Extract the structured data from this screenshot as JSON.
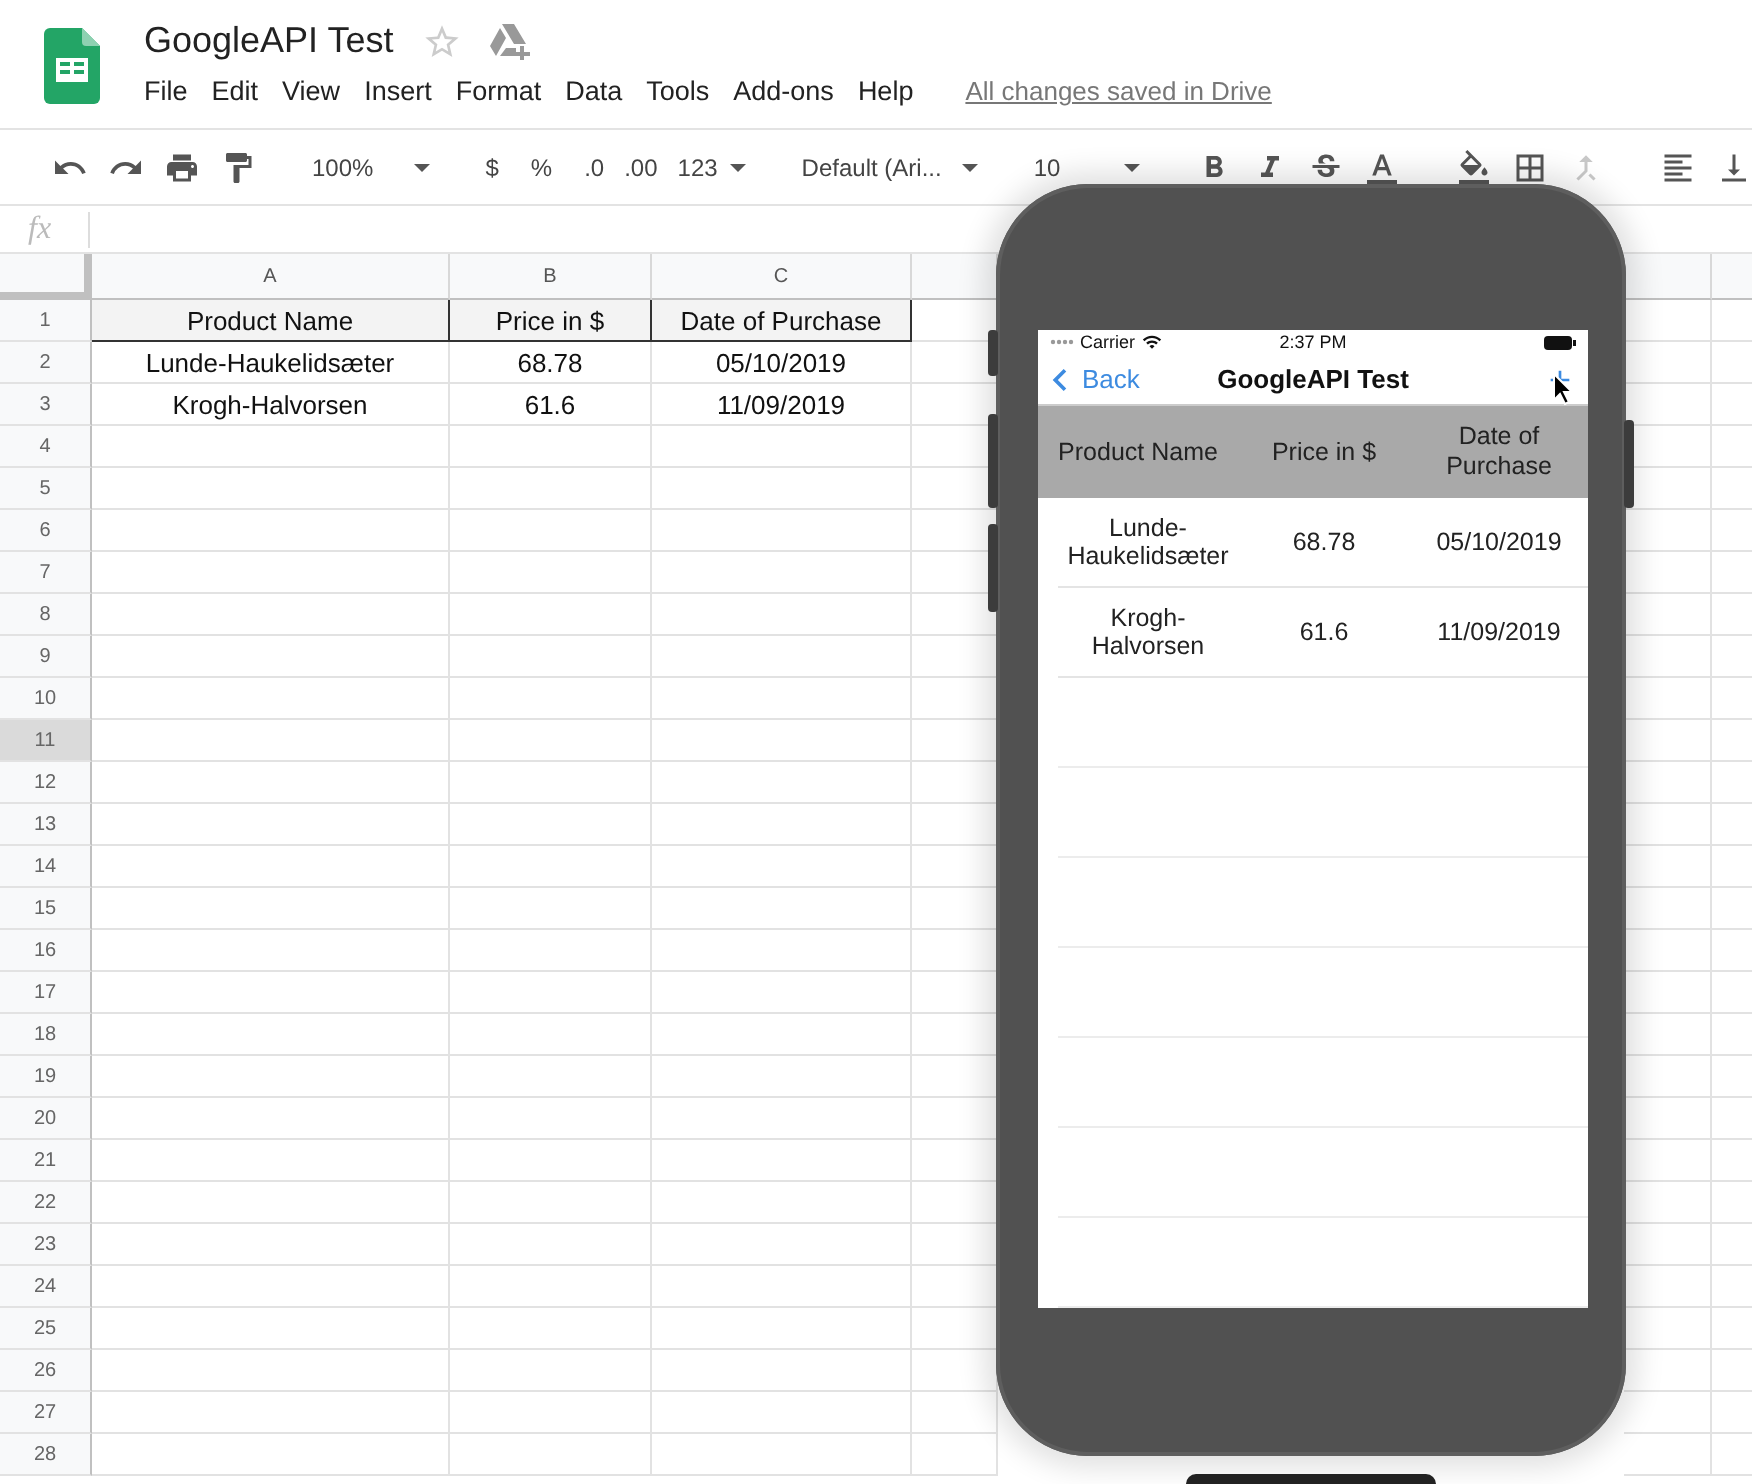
{
  "document": {
    "title": "GoogleAPI Test",
    "starred": false,
    "menu": [
      "File",
      "Edit",
      "View",
      "Insert",
      "Format",
      "Data",
      "Tools",
      "Add-ons",
      "Help"
    ],
    "save_status": "All changes saved in Drive"
  },
  "toolbar": {
    "zoom": "100%",
    "currency": "$",
    "percent": "%",
    "decrease_decimals": ".0",
    "increase_decimals": ".00",
    "more_formats": "123",
    "font": "Default (Ari...",
    "font_size": "10",
    "merge_disabled": true
  },
  "formula_bar": {
    "label": "fx"
  },
  "sheet": {
    "columns": [
      "A",
      "B",
      "C"
    ],
    "rows": [
      {
        "number": "1",
        "selected": false,
        "kind": "header",
        "cells": [
          "Product Name",
          "Price in $",
          "Date of Purchase"
        ]
      },
      {
        "number": "2",
        "selected": false,
        "kind": "data",
        "cells": [
          "Lunde-Haukelidsæter",
          "68.78",
          "05/10/2019"
        ]
      },
      {
        "number": "3",
        "selected": false,
        "kind": "data",
        "cells": [
          "Krogh-Halvorsen",
          "61.6",
          "11/09/2019"
        ]
      },
      {
        "number": "4",
        "selected": false,
        "kind": "empty"
      },
      {
        "number": "5",
        "selected": false,
        "kind": "empty"
      },
      {
        "number": "6",
        "selected": false,
        "kind": "empty"
      },
      {
        "number": "7",
        "selected": false,
        "kind": "empty"
      },
      {
        "number": "8",
        "selected": false,
        "kind": "empty"
      },
      {
        "number": "9",
        "selected": false,
        "kind": "empty"
      },
      {
        "number": "10",
        "selected": false,
        "kind": "empty"
      },
      {
        "number": "11",
        "selected": true,
        "kind": "empty"
      },
      {
        "number": "12",
        "selected": false,
        "kind": "empty"
      },
      {
        "number": "13",
        "selected": false,
        "kind": "empty"
      },
      {
        "number": "14",
        "selected": false,
        "kind": "empty"
      },
      {
        "number": "15",
        "selected": false,
        "kind": "empty"
      },
      {
        "number": "16",
        "selected": false,
        "kind": "empty"
      },
      {
        "number": "17",
        "selected": false,
        "kind": "empty"
      },
      {
        "number": "18",
        "selected": false,
        "kind": "empty"
      },
      {
        "number": "19",
        "selected": false,
        "kind": "empty"
      },
      {
        "number": "20",
        "selected": false,
        "kind": "empty"
      },
      {
        "number": "21",
        "selected": false,
        "kind": "empty"
      },
      {
        "number": "22",
        "selected": false,
        "kind": "empty"
      },
      {
        "number": "23",
        "selected": false,
        "kind": "empty"
      },
      {
        "number": "24",
        "selected": false,
        "kind": "empty"
      },
      {
        "number": "25",
        "selected": false,
        "kind": "empty"
      },
      {
        "number": "26",
        "selected": false,
        "kind": "empty"
      },
      {
        "number": "27",
        "selected": false,
        "kind": "empty"
      },
      {
        "number": "28",
        "selected": false,
        "kind": "empty"
      }
    ]
  },
  "phone": {
    "carrier": "Carrier",
    "time": "2:37 PM",
    "back": "Back",
    "title": "GoogleAPI Test",
    "columns": [
      "Product Name",
      "Price in $",
      "Date of\nPurchase"
    ],
    "rows": [
      [
        "Lunde-Haukelidsæter",
        "68.78",
        "05/10/2019"
      ],
      [
        "Krogh-Halvorsen",
        "61.6",
        "11/09/2019"
      ]
    ]
  }
}
